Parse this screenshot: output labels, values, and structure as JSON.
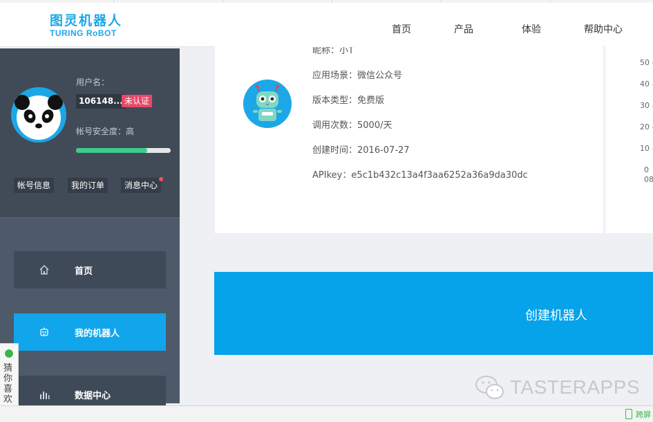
{
  "header": {
    "logo_cn": "图灵机器人",
    "logo_en": "TURING RoBOT",
    "nav": [
      "首页",
      "产品",
      "体验",
      "帮助中心"
    ]
  },
  "sidebar": {
    "username_label": "用户名：",
    "username": "106148...",
    "verify_badge": "未认证",
    "security_label": "帐号安全度：高",
    "security_progress": 0.75,
    "buttons": [
      "帐号信息",
      "我的订单",
      "消息中心"
    ],
    "menu": [
      {
        "label": "首页",
        "icon": "home-icon"
      },
      {
        "label": "我的机器人",
        "icon": "robot-icon"
      },
      {
        "label": "数据中心",
        "icon": "bar-chart-icon"
      }
    ],
    "float_tag": "猜你喜欢"
  },
  "robot_card": {
    "nickname": "昵称：小T",
    "scene": "应用场景：微信公众号",
    "version": "版本类型：免费版",
    "calls": "调用次数：5000/天",
    "created": "创建时间：2016-07-27",
    "apikey": "APIkey：e5c1b432c13a4f3aa6252a36a9da30dc"
  },
  "right_chart": {
    "ticks": [
      "50",
      "40",
      "30",
      "20",
      "10",
      "0"
    ],
    "partial_label": "08"
  },
  "create_button": "创建机器人",
  "watermark": "TASTERAPPS",
  "statusbar": {
    "text": "跨屏"
  },
  "colors": {
    "accent": "#06a2ea",
    "sidebar": "#4e5a6a",
    "badge": "#e8486a",
    "progress": "#3fcb8c"
  }
}
